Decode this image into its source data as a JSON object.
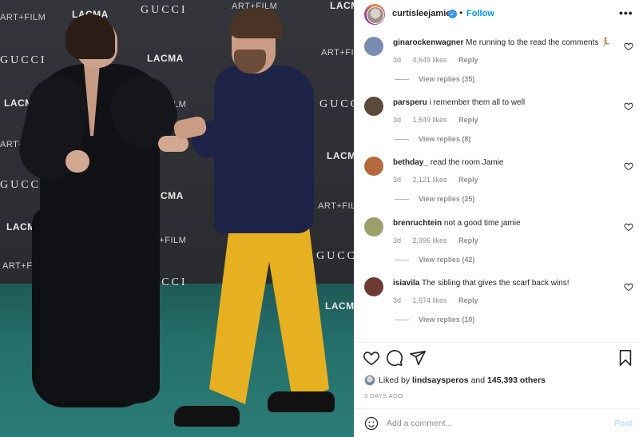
{
  "photo": {
    "backdrop_logos": {
      "gucci": "GUCCI",
      "lacma": "LACMA",
      "artfilm": "ART+FILM"
    }
  },
  "post_header": {
    "username": "curtisleejamie",
    "verified_mark": "✓",
    "separator": "•",
    "follow_label": "Follow",
    "more_label": "•••"
  },
  "comments": [
    {
      "username": "ginarockenwagner",
      "text": "Me running to the read the comments 🏃",
      "age": "3d",
      "likes": "4,649 likes",
      "reply_label": "Reply",
      "view_replies": "View replies (35)",
      "avatar_color": "#7a8db1"
    },
    {
      "username": "parsperu",
      "text": "i remember them all to well",
      "age": "3d",
      "likes": "1,649 likes",
      "reply_label": "Reply",
      "view_replies": "View replies (8)",
      "avatar_color": "#5a4a3a"
    },
    {
      "username": "bethday_",
      "text": "read the room Jamie",
      "age": "3d",
      "likes": "2,121 likes",
      "reply_label": "Reply",
      "view_replies": "View replies (25)",
      "avatar_color": "#b56a3e"
    },
    {
      "username": "brenruchtein",
      "text": "not a good time jamie",
      "age": "3d",
      "likes": "2,996 likes",
      "reply_label": "Reply",
      "view_replies": "View replies (42)",
      "avatar_color": "#9aa06a"
    },
    {
      "username": "isiavila",
      "text": "The sibling that gives the scarf back wins!",
      "age": "3d",
      "likes": "1,674 likes",
      "reply_label": "Reply",
      "view_replies": "View replies (10)",
      "avatar_color": "#6e3b34"
    }
  ],
  "actions": {
    "liked_prefix": "Liked by",
    "liked_user": "lindsaysperos",
    "liked_and": "and",
    "liked_others": "145,393 others",
    "post_age": "3 DAYS AGO"
  },
  "comment_box": {
    "placeholder": "Add a comment...",
    "post_label": "Post"
  },
  "colors": {
    "accent": "#0095f6",
    "post_disabled": "#b2dffc",
    "muted": "#8e8e8e"
  }
}
